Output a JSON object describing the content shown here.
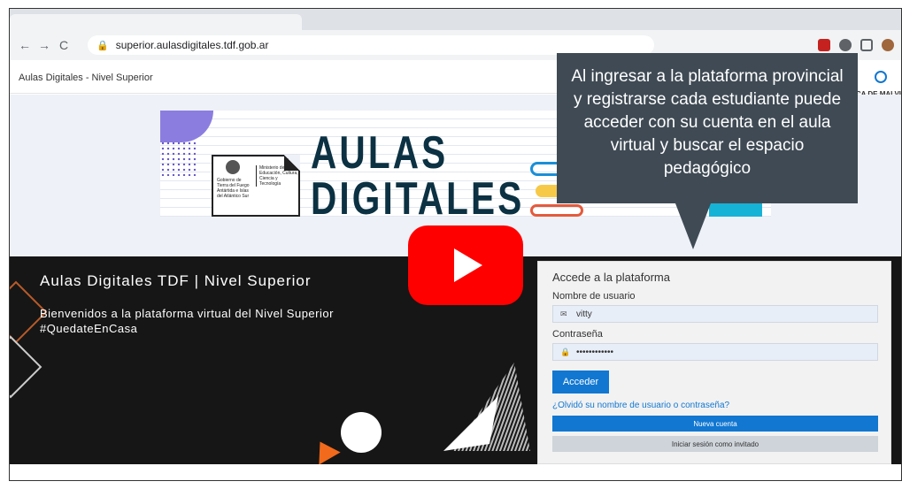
{
  "browser": {
    "url": "superior.aulasdigitales.tdf.gob.ar",
    "nav_back": "←",
    "nav_forward": "→",
    "nav_reload": "C"
  },
  "site": {
    "title": "Aulas Digitales - Nivel Superior",
    "right_text": "EROICA DE MALVI"
  },
  "banner": {
    "word1": "AULAS",
    "word2": "DIGITALES",
    "gov_text": "Gobierno de Tierra del Fuego Antártida e Islas del Atlántico Sur",
    "ministry_text": "Ministerio de Educación, Cultura, Ciencia y Tecnología"
  },
  "hero": {
    "title": "Aulas Digitales TDF | Nivel Superior",
    "subtitle": "Bienvenidos a la plataforma virtual del Nivel Superior #QuedateEnCasa"
  },
  "login": {
    "heading": "Accede a la plataforma",
    "username_label": "Nombre de usuario",
    "username_value": "vitty",
    "password_label": "Contraseña",
    "password_value": "••••••••••••",
    "submit_label": "Acceder",
    "forgot_label": "¿Olvidó su nombre de usuario o contraseña?",
    "new_account_label": "Nueva cuenta",
    "guest_label": "Iniciar sesión como invitado"
  },
  "tooltip": {
    "text": "Al ingresar a la plataforma provincial y registrarse cada estudiante puede acceder con su cuenta en el aula virtual y buscar el espacio pedagógico"
  },
  "colors": {
    "accent": "#1177d1",
    "tooltip_bg": "#3f4a54",
    "youtube_red": "#ff0000",
    "dark_bg": "#161616"
  }
}
